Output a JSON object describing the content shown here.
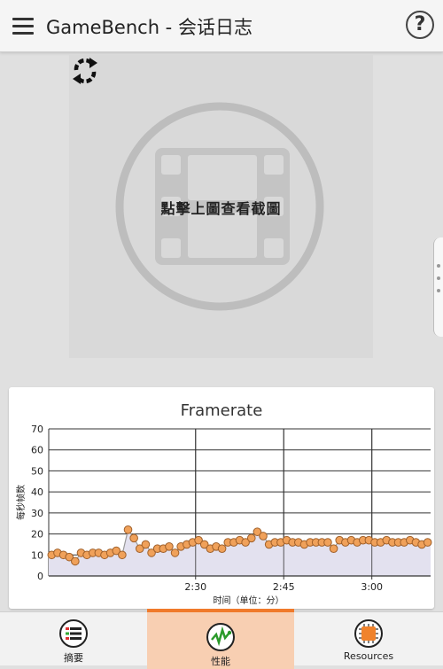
{
  "appbar": {
    "title": "GameBench - 会话日志",
    "menu_icon": "menu-icon",
    "help_icon": "help-icon",
    "help_glyph": "?"
  },
  "screenshot": {
    "label": "點擊上圖查看截圖",
    "placeholder_icon": "film-icon",
    "refresh_icon": "refresh-icon"
  },
  "chart_data": {
    "type": "line",
    "title": "Framerate",
    "xlabel": "时间（单位：分）",
    "ylabel": "每秒帧数",
    "ylim": [
      0,
      70
    ],
    "yticks": [
      0,
      10,
      20,
      30,
      40,
      50,
      60,
      70
    ],
    "xlim_seconds": [
      125,
      190
    ],
    "xticks": [
      {
        "label": "2:30",
        "sec": 150
      },
      {
        "label": "2:45",
        "sec": 165
      },
      {
        "label": "3:00",
        "sec": 180
      }
    ],
    "grid": true,
    "colors": {
      "line": "#999999",
      "fill": "#e3e1ef",
      "point": "#f0a15a",
      "point_edge": "#a0602a",
      "grid": "#333333"
    },
    "series": [
      {
        "x": [
          125.5,
          126.5,
          127.5,
          128.5,
          129.5,
          130.5,
          131.5,
          132.5,
          133.5,
          134.5,
          135.5,
          136.5,
          137.5,
          138.5,
          139.5,
          140.5,
          141.5,
          142.5,
          143.5,
          144.5,
          145.5,
          146.5,
          147.5,
          148.5,
          149.5,
          150.5,
          151.5,
          152.5,
          153.5,
          154.5,
          155.5,
          156.5,
          157.5,
          158.5,
          159.5,
          160.5,
          161.5,
          162.5,
          163.5,
          164.5,
          165.5,
          166.5,
          167.5,
          168.5,
          169.5,
          170.5,
          171.5,
          172.5,
          173.5,
          174.5,
          175.5,
          176.5,
          177.5,
          178.5,
          179.5,
          180.5,
          181.5,
          182.5,
          183.5,
          184.5,
          185.5,
          186.5,
          187.5,
          188.5,
          189.5
        ],
        "values": [
          10,
          11,
          10,
          9,
          7,
          11,
          10,
          11,
          11,
          10,
          11,
          12,
          10,
          22,
          18,
          13,
          15,
          11,
          13,
          13,
          14,
          11,
          14,
          15,
          16,
          17,
          15,
          13,
          14,
          13,
          16,
          16,
          17,
          16,
          18,
          21,
          19,
          15,
          16,
          16,
          17,
          16,
          16,
          15,
          16,
          16,
          16,
          16,
          13,
          17,
          16,
          17,
          16,
          17,
          17,
          16,
          16,
          17,
          16,
          16,
          16,
          17,
          16,
          15,
          16
        ]
      }
    ]
  },
  "bottomnav": {
    "items": [
      {
        "label": "摘要",
        "icon": "summary-list-icon",
        "active": false
      },
      {
        "label": "性能",
        "icon": "performance-graph-icon",
        "active": true
      },
      {
        "label": "Resources",
        "icon": "cpu-chip-icon",
        "active": false
      }
    ]
  }
}
